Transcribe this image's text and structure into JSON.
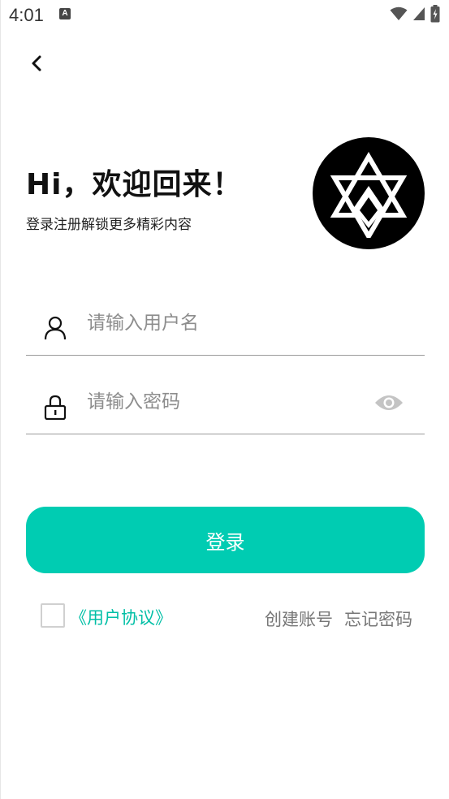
{
  "status_bar": {
    "time": "4:01",
    "app_icon_letter": "A",
    "icons": [
      "wifi-icon",
      "cell-signal-icon",
      "battery-charging-icon"
    ]
  },
  "header": {
    "back_icon": "chevron-left-icon",
    "title": "Hi，欢迎回来！",
    "subtitle": "登录注册解锁更多精彩内容",
    "logo_icon": "star-of-david-logo"
  },
  "form": {
    "username": {
      "icon": "user-icon",
      "placeholder": "请输入用户名",
      "value": ""
    },
    "password": {
      "icon": "lock-icon",
      "placeholder": "请输入密码",
      "value": "",
      "toggle_icon": "eye-icon"
    },
    "login_label": "登录"
  },
  "footer": {
    "agreement_checked": false,
    "agreement_label": "《用户协议》",
    "create_account": "创建账号",
    "forgot_password": "忘记密码"
  },
  "colors": {
    "accent": "#00ccb2",
    "link": "#00bfa6",
    "secondary_text": "#777777"
  }
}
